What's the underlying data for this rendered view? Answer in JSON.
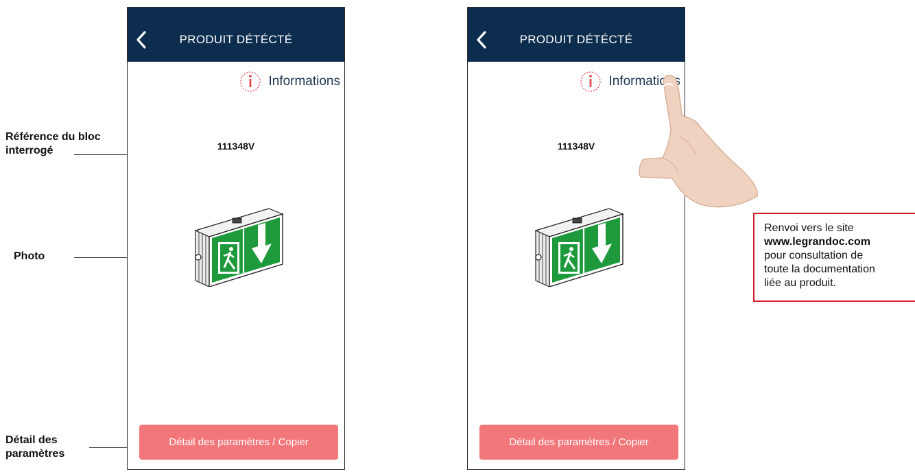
{
  "screens": [
    {
      "header": {
        "title": "PRODUIT DÉTÉCTÉ"
      },
      "info_link": {
        "label": "Informations"
      },
      "reference": "111348V",
      "action_button": {
        "label": "Détail des paramètres / Copier"
      }
    },
    {
      "header": {
        "title": "PRODUIT DÉTÉCTÉ"
      },
      "info_link": {
        "label": "Informations"
      },
      "reference": "111348V",
      "action_button": {
        "label": "Détail des paramètres / Copier"
      }
    }
  ],
  "annotations": {
    "reference_line1": "Référence du bloc",
    "reference_line2": "interrogé",
    "photo": "Photo",
    "details_line1": "Détail des",
    "details_line2": "paramètres"
  },
  "note": {
    "line1": "Renvoi vers le site",
    "url": "www.legrandoc.com",
    "line3": "pour consultation de",
    "line4": "toute la documentation",
    "line5": "liée au produit."
  },
  "colors": {
    "header_bg": "#0d2d4e",
    "button_bg": "#f2777b",
    "info_icon": "#e04a4f",
    "note_border": "#d3202b",
    "sign_green": "#1e9a3c"
  },
  "icons": [
    "back-chevron-icon",
    "info-icon",
    "emergency-exit-sign",
    "pointing-hand"
  ]
}
